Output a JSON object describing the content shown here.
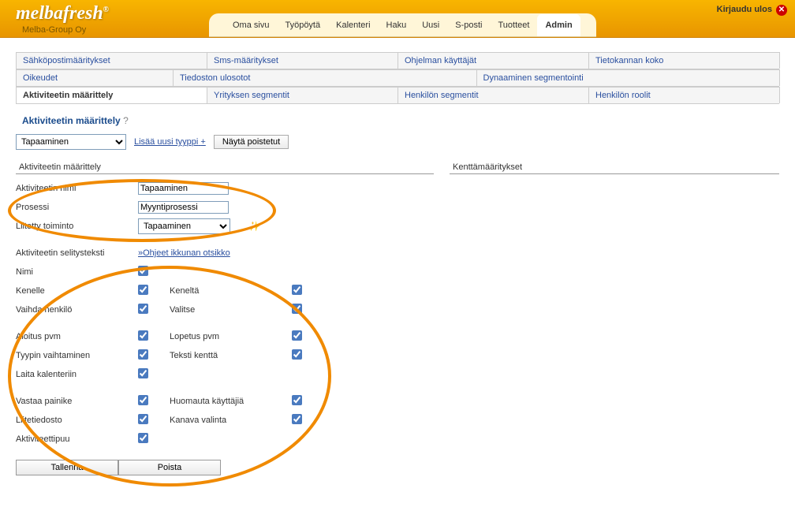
{
  "header": {
    "logo": "melbafresh",
    "tm": "®",
    "company": "Melba-Group Oy",
    "logout": "Kirjaudu ulos"
  },
  "nav": {
    "items": [
      "Oma sivu",
      "Työpöytä",
      "Kalenteri",
      "Haku",
      "Uusi",
      "S-posti",
      "Tuotteet",
      "Admin"
    ],
    "active": "Admin"
  },
  "tabs1": [
    "Sähköpostimääritykset",
    "Sms-määritykset",
    "Ohjelman käyttäjät",
    "Tietokannan koko"
  ],
  "tabs2": [
    "Oikeudet",
    "Tiedoston ulosotot",
    "Dynaaminen segmentointi"
  ],
  "tabs3": [
    "Aktiviteetin määrittely",
    "Yrityksen segmentit",
    "Henkilön segmentit",
    "Henkilön roolit"
  ],
  "tabs3_active": "Aktiviteetin määrittely",
  "page": {
    "title": "Aktiviteetin määrittely",
    "help": "?",
    "type_select": "Tapaaminen",
    "add_type": "Lisää uusi tyyppi",
    "add_icon": "+",
    "show_deleted": "Näytä poistetut"
  },
  "left": {
    "header": "Aktiviteetin määrittely",
    "name_lbl": "Aktiviteetin nimi",
    "name_val": "Tapaaminen",
    "process_lbl": "Prosessi",
    "process_val": "Myyntiprosessi",
    "linked_lbl": "Liitetty toiminto",
    "linked_val": "Tapaaminen",
    "desc_lbl": "Aktiviteetin selitysteksti",
    "desc_link": "»Ohjeet ikkunan otsikko",
    "rows": {
      "nimi": "Nimi",
      "kenelle": "Kenelle",
      "kenelta": "Keneltä",
      "vaihda": "Vaihda henkilö",
      "valitse": "Valitse",
      "aloitus": "Aloitus pvm",
      "lopetus": "Lopetus pvm",
      "tyypin": "Tyypin vaihtaminen",
      "teksti": "Teksti kenttä",
      "kalenteri": "Laita kalenteriin",
      "vastaa": "Vastaa painike",
      "huomauta": "Huomauta käyttäjiä",
      "liite": "Liitetiedosto",
      "kanava": "Kanava valinta",
      "puu": "Aktiviteettipuu"
    },
    "save": "Tallenna",
    "delete": "Poista"
  },
  "right": {
    "header": "Kenttämääritykset"
  }
}
